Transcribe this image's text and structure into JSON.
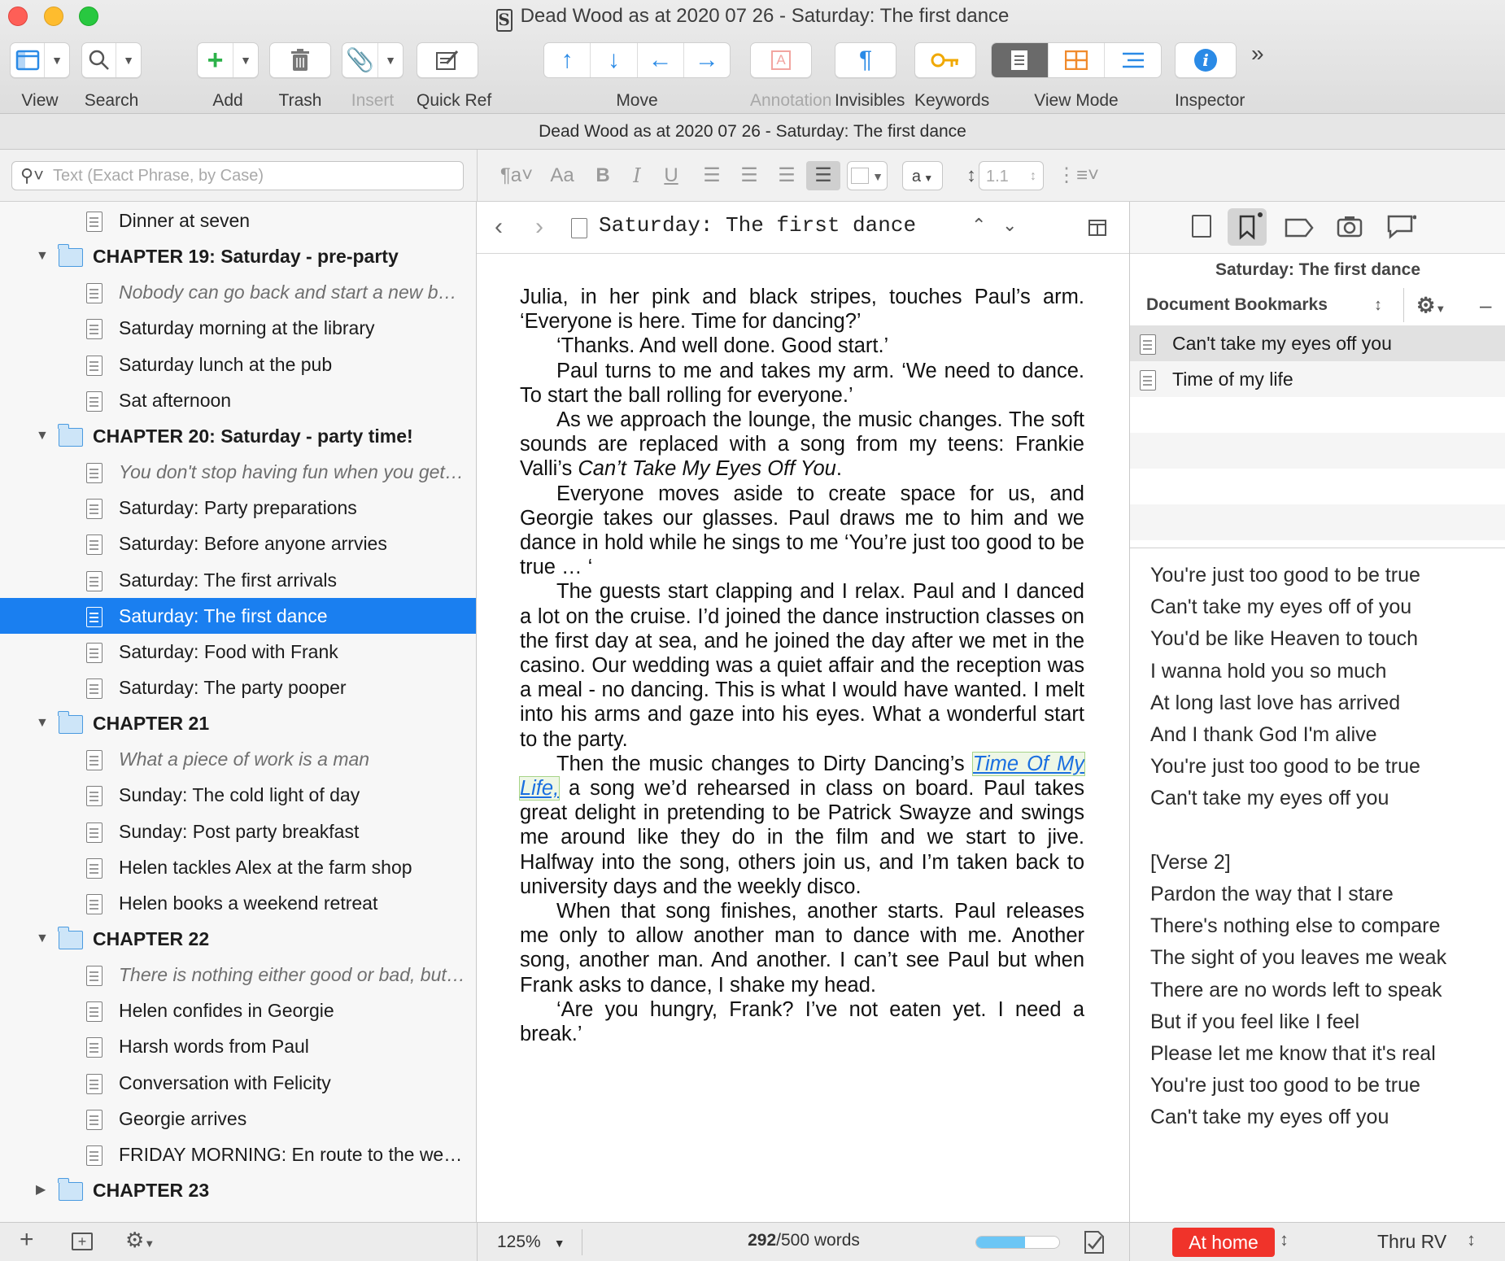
{
  "window": {
    "title": "Dead Wood as at 2020 07 26 - Saturday: The first dance",
    "app_icon_glyph": "S"
  },
  "toolbar": {
    "view": "View",
    "search": "Search",
    "add": "Add",
    "trash": "Trash",
    "insert": "Insert",
    "quick_ref": "Quick Ref",
    "move": "Move",
    "annotation": "Annotation",
    "invisibles": "Invisibles",
    "keywords": "Keywords",
    "view_mode": "View Mode",
    "inspector": "Inspector"
  },
  "path_bar": "Dead Wood as at 2020 07 26 - Saturday: The first dance",
  "binder_search": {
    "placeholder": "Text (Exact Phrase, by Case)"
  },
  "format_bar": {
    "font_size_label": "Aa",
    "bold": "B",
    "italic": "I",
    "underline": "U",
    "text_color": "a",
    "line_spacing": "1.1"
  },
  "binder": {
    "items": [
      {
        "label": "Dinner at seven",
        "kind": "doc"
      },
      {
        "label": "CHAPTER 19: Saturday - pre-party",
        "kind": "chapter"
      },
      {
        "label": "Nobody can go back and start a new beginning…",
        "kind": "note"
      },
      {
        "label": "Saturday morning at the library",
        "kind": "doc"
      },
      {
        "label": "Saturday lunch at the pub",
        "kind": "doc"
      },
      {
        "label": "Sat afternoon",
        "kind": "doc"
      },
      {
        "label": "CHAPTER 20: Saturday - party time!",
        "kind": "chapter"
      },
      {
        "label": "You don't stop having fun when you get old…",
        "kind": "note"
      },
      {
        "label": "Saturday: Party preparations",
        "kind": "doc"
      },
      {
        "label": "Saturday: Before anyone arrvies",
        "kind": "doc"
      },
      {
        "label": "Saturday: The first arrivals",
        "kind": "doc"
      },
      {
        "label": "Saturday: The first dance",
        "kind": "doc",
        "selected": true
      },
      {
        "label": "Saturday: Food with Frank",
        "kind": "doc"
      },
      {
        "label": "Saturday: The party pooper",
        "kind": "doc"
      },
      {
        "label": "CHAPTER 21",
        "kind": "chapter"
      },
      {
        "label": "What a piece of work is a man",
        "kind": "note"
      },
      {
        "label": "Sunday: The cold light of day",
        "kind": "doc"
      },
      {
        "label": "Sunday: Post party breakfast",
        "kind": "doc"
      },
      {
        "label": "Helen tackles Alex at the farm shop",
        "kind": "doc"
      },
      {
        "label": "Helen books a weekend retreat",
        "kind": "doc"
      },
      {
        "label": "CHAPTER 22",
        "kind": "chapter"
      },
      {
        "label": "There is nothing either good or bad, but thinking makes it so",
        "kind": "note"
      },
      {
        "label": "Helen confides in Georgie",
        "kind": "doc"
      },
      {
        "label": "Harsh words from Paul",
        "kind": "doc"
      },
      {
        "label": "Conversation with Felicity",
        "kind": "doc"
      },
      {
        "label": "Georgie arrives",
        "kind": "doc"
      },
      {
        "label": "FRIDAY MORNING: En route to the weekend",
        "kind": "doc"
      },
      {
        "label": "CHAPTER 23",
        "kind": "chapter",
        "collapsed": true
      }
    ]
  },
  "editor": {
    "doc_title": "Saturday: The first dance",
    "paragraphs": [
      "Julia, in her pink and black stripes, touches Paul’s arm. ‘Everyone is here. Time for dancing?’",
      "‘Thanks. And well done. Good start.’",
      "Paul turns to me and takes my arm. ‘We need to dance. To start the ball rolling for everyone.’",
      "As we approach the lounge, the music changes. The soft sounds are replaced with a song from my teens: Frankie Valli’s ",
      "Everyone moves aside to create space for us, and Georgie takes our glasses. Paul draws me to him and we dance in hold while he sings to me ‘You’re just too good to be true … ‘",
      "The guests start clapping and I relax. Paul and I danced a lot on the cruise. I’d joined the dance instruction classes on the first day at sea, and he joined the day after we met in the casino. Our wedding was a quiet affair and the reception was a meal - no dancing. This is what I would have wanted. I melt into his arms and gaze into his eyes. What a wonderful start to the party.",
      "Then the music changes to Dirty Dancing’s ",
      "When that song finishes, another starts. Paul releases me only to allow another man to dance with me. Another song, another man. And another. I can’t see Paul but when Frank asks to dance, I shake my head.",
      "‘Are you hungry, Frank? I’ve not eaten yet. I need a break.’"
    ],
    "song_title_1": "Can’t Take My Eyes Off You",
    "song_title_1_end": ".",
    "link_text": "Time Of My Life,",
    "after_link": " a song we’d rehearsed in class on board. Paul takes great delight in pretending to be Patrick Swayze and swings me around like they do in the film and we start to jive. Halfway into the song, others join us, and I’m taken back to university days and the weekly disco."
  },
  "inspector": {
    "title": "Saturday: The first dance",
    "section": "Document Bookmarks",
    "bookmarks": [
      "Can't take my eyes off you",
      "Time of my life"
    ],
    "lyrics": "You're just too good to be true\nCan't take my eyes off of you\nYou'd be like Heaven to touch\nI wanna hold you so much\nAt long last love has arrived\nAnd I thank God I'm alive\nYou're just too good to be true\nCan't take my eyes off you\n\n[Verse 2]\nPardon the way that I stare\nThere's nothing else to compare\nThe sight of you leaves me weak\nThere are no words left to speak\nBut if you feel like I feel\nPlease let me know that it's real\nYou're just too good to be true\nCan't take my eyes off you"
  },
  "footer": {
    "zoom": "125%",
    "word_count": "292",
    "word_target": "/500 words",
    "target_progress": 0.584,
    "status": "At home",
    "label": "Thru RV"
  },
  "colors": {
    "selection": "#1a7ff0",
    "status_badge": "#f0332a",
    "progress": "#6cc6f5"
  }
}
